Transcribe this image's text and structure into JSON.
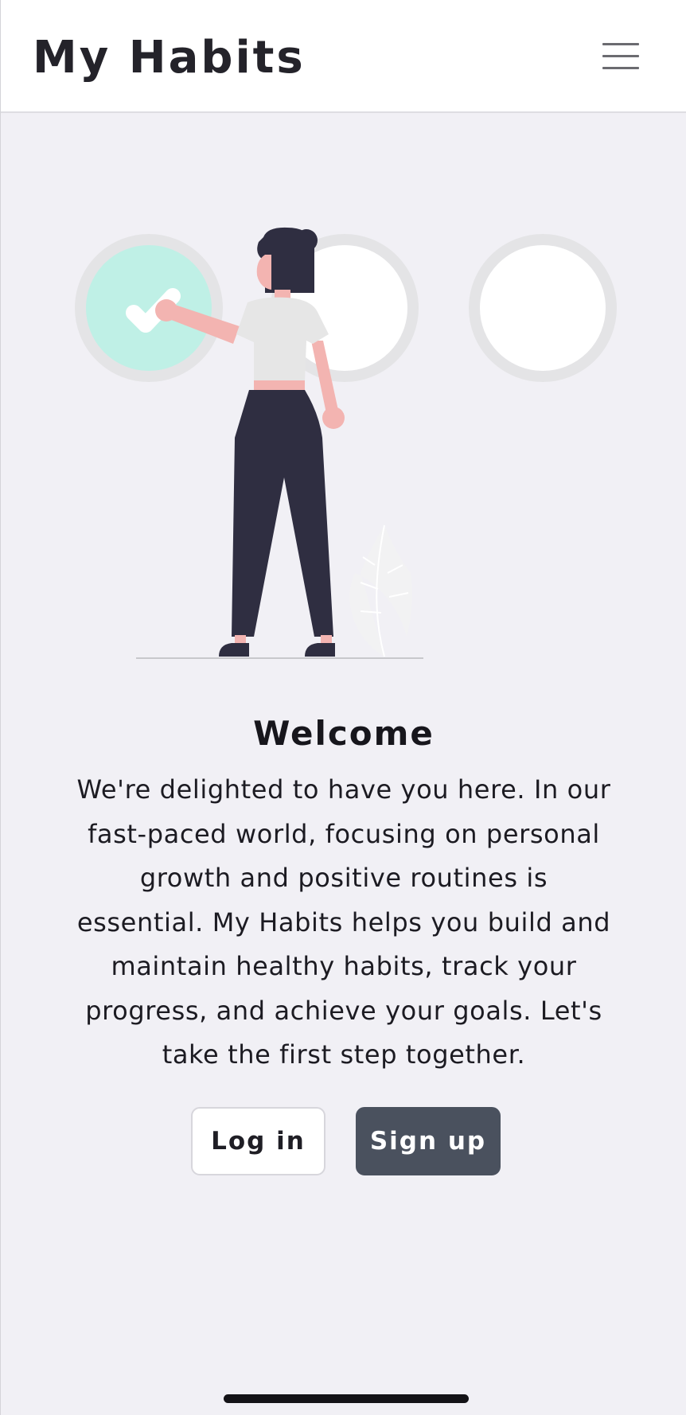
{
  "header": {
    "title": "My Habits",
    "menu_icon": "hamburger-menu-icon"
  },
  "illustration": {
    "icon": "woman-checking-habit-circles-illustration",
    "circles": [
      {
        "state": "checked",
        "fill": "#bff0e6"
      },
      {
        "state": "unchecked",
        "fill": "#ffffff"
      },
      {
        "state": "unchecked",
        "fill": "#ffffff"
      }
    ],
    "check_icon": "checkmark-icon"
  },
  "welcome": {
    "title": "Welcome",
    "body": "We're delighted to have you here. In our fast-paced world, focusing on personal growth and positive routines is essential. My Habits helps you build and maintain healthy habits, track your progress, and achieve your goals. Let's take the first step together."
  },
  "actions": {
    "login_label": "Log in",
    "signup_label": "Sign up"
  },
  "colors": {
    "background": "#f1f0f5",
    "header": "#ffffff",
    "primary_button": "#4a515e",
    "accent": "#bff0e6"
  }
}
